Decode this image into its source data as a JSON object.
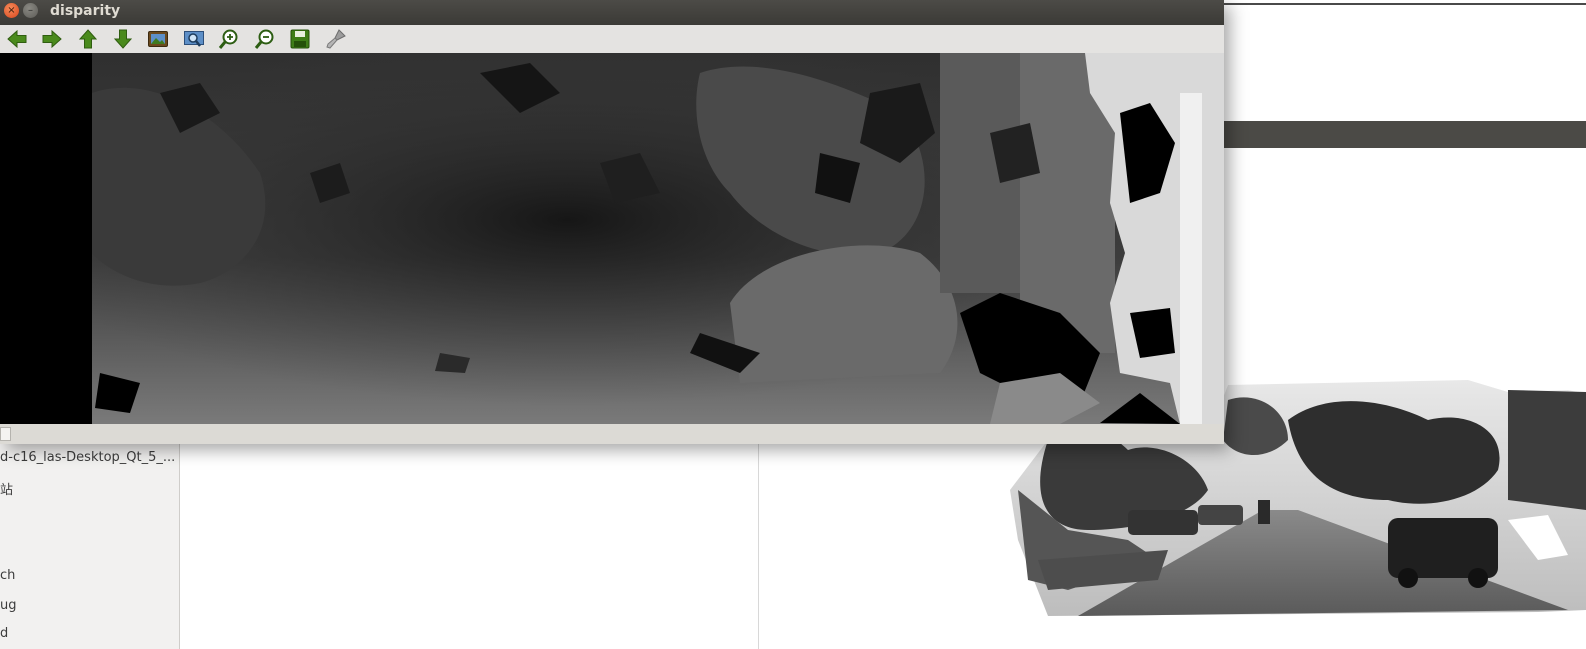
{
  "window": {
    "title": "disparity",
    "close_glyph": "×",
    "minimize_glyph": "–"
  },
  "toolbar": {
    "icons": [
      "arrow-left-icon",
      "arrow-right-icon",
      "arrow-up-icon",
      "arrow-down-icon",
      "image-icon",
      "zoom-region-icon",
      "zoom-in-icon",
      "zoom-out-icon",
      "save-icon",
      "brush-icon"
    ]
  },
  "background": {
    "project_item": "d-c16_las-Desktop_Qt_5_...",
    "site_item": "站",
    "item_ch": "ch",
    "item_ug": "ug",
    "item_d": "d"
  },
  "colors": {
    "titlebar": "#3f3e3a",
    "toolbar_icon_green": "#4a8a1c",
    "close_button": "#e2531f"
  }
}
